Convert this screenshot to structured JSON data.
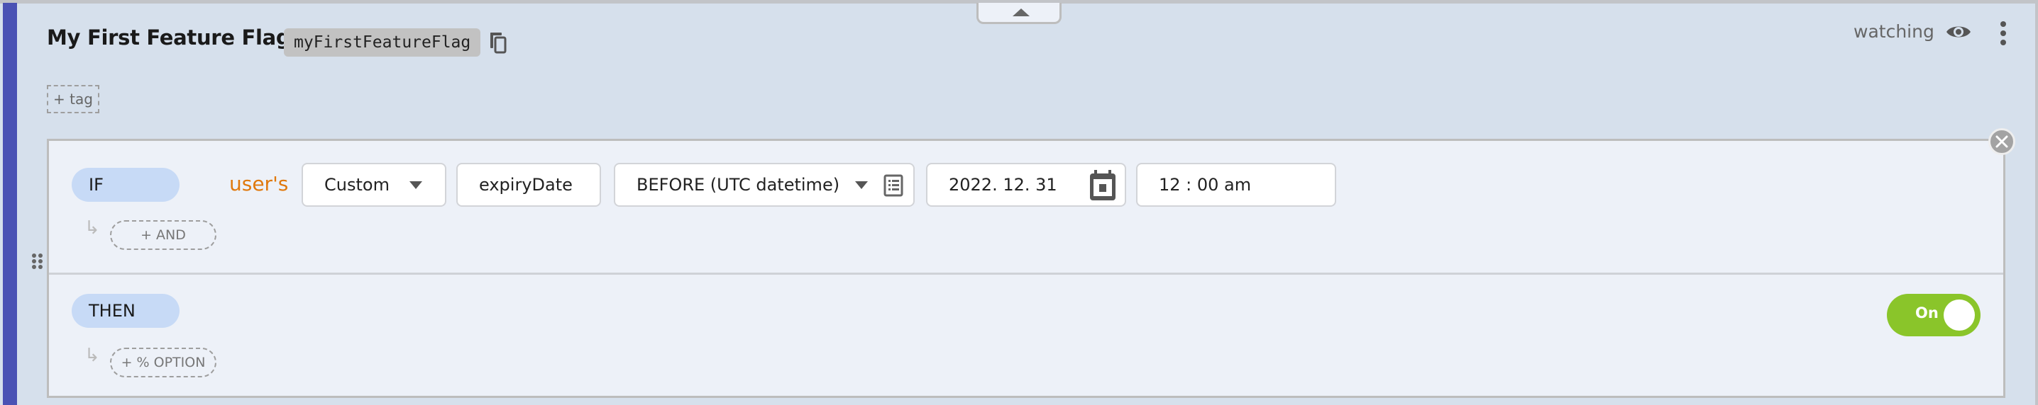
{
  "header": {
    "title": "My First Feature Flag",
    "flag_key": "myFirstFeatureFlag",
    "add_tag_label": "+ tag",
    "watch_status": "watching",
    "icons": {
      "copy": "copy-icon",
      "eye": "eye-icon",
      "more": "kebab-menu-icon",
      "collapse": "chevron-up-icon"
    }
  },
  "rule": {
    "if_label": "IF",
    "subject_label": "user's",
    "attribute_type": "Custom",
    "attribute_name": "expiryDate",
    "operator": "BEFORE (UTC datetime)",
    "date_value": "2022. 12. 31",
    "time_value": "12 : 00   am",
    "add_and_label": "+ AND",
    "then_label": "THEN",
    "add_option_label": "+ % OPTION",
    "toggle_label": "On",
    "toggle_on": true,
    "colors": {
      "accent_bar": "#4a52b4",
      "pill": "#c7daf6",
      "subject": "#e0790d",
      "toggle_on": "#8ac52a",
      "panel_bg": "#d6e0ec",
      "rule_bg": "#edf1f8"
    }
  }
}
